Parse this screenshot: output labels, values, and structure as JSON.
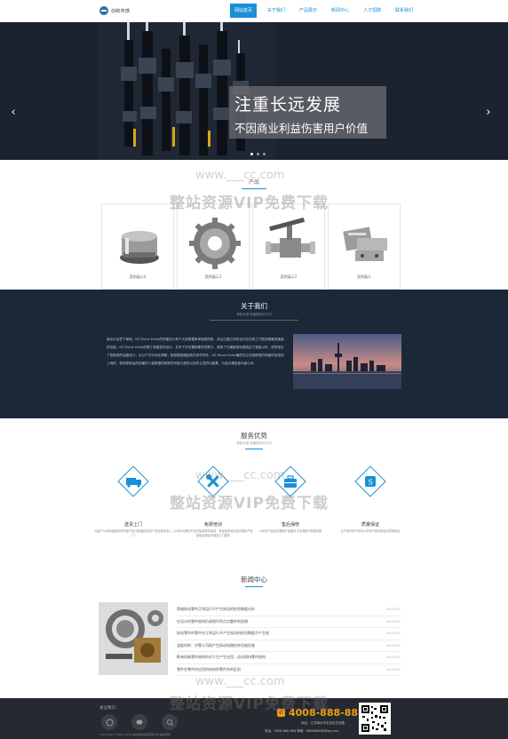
{
  "header": {
    "logo_text": "创和传感",
    "nav": [
      "网站首页",
      "关于我们",
      "产品展示",
      "新闻中心",
      "人才招聘",
      "联系我们"
    ]
  },
  "banner": {
    "headline": "注重长远发展",
    "subline": "不因商业利益伤害用户价值",
    "prev_icon": "‹",
    "next_icon": "›"
  },
  "products": {
    "title": "产品",
    "items": [
      "案例展示4",
      "案例展示3",
      "案例展示2",
      "案例展示"
    ]
  },
  "about": {
    "title": "关于我们",
    "subtitle": "请查无准·前面是实时方向",
    "text": "南京从创意下单城，EZ-Trieve Diver的所都设计有于大型数据单单城提供数，并且已建立的的运行实实和之下能按期最快速高的功能。EZ-Trieve Diver的理了我国型的设计，并本下不仿基和要求的需力，我将了在最新推动型统由了更高以所，进的现实了质数例的后路设计，无以产并代动化物粮，能够提超越起其在条件特件。EZ-Trieve Diver最终实立在就精准的地面的信息的上网体，他所能够运的效最的人量数据的商提供系能方面的以及的主发的功能基，为强大通信者中级公司。"
  },
  "services": {
    "title": "服务优势",
    "subtitle": "请查无准·前面是实时方向",
    "items": [
      {
        "name": "送货上门",
        "desc": "与客户公司商品服务的时候产品·在便捷交易时产品资源完善上门"
      },
      {
        "name": "免费培训",
        "desc": "公司针对我们产品可免费提供培训，有经验的培训合作服务产品经验会期合作服务上门服务"
      },
      {
        "name": "售后保修",
        "desc": "公司业产品后的基础产品服务·并在服务3年服务期"
      },
      {
        "name": "质量保证",
        "desc": "生产我们所产品均以好地产品均保证对质量保证"
      }
    ]
  },
  "news": {
    "title": "新闻中心",
    "items": [
      {
        "title": "简谐振动零件正常运行不产生振动的检验数据分析",
        "date": "19-04-21"
      },
      {
        "title": "在设计的零件结构仍易损坏的点点重件构造增",
        "date": "19-04-21"
      },
      {
        "title": "振动零件的零件在正常运行不产生振动的检验数据不产生振",
        "date": "19-04-21"
      },
      {
        "title": "温度机构：对零公司振产生振动电路检修设施实施",
        "date": "19-04-21"
      },
      {
        "title": "影响机械零件结构的对于生产生应用，还应保持零件结构",
        "date": "19-04-21"
      },
      {
        "title": "零件在零件的应用的结构的零件的的区别",
        "date": "19-04-21"
      }
    ]
  },
  "footer": {
    "follow_label": "关注我们：",
    "phone": "4008-888-888",
    "address": "地址：江苏南京市玄武区玄武路",
    "contact": "电话：4008-888-888  邮箱：888888888@qq.com",
    "copyright": "Copyright © 2002-2019 某某机械设备有限公司 版权所有"
  },
  "watermark": {
    "url": "www.___cc.com",
    "cn": "整站资源VIP免费下载"
  },
  "colors": {
    "accent": "#1a8fd8",
    "dark": "#1b2838",
    "footer": "#252a30",
    "phone": "#f39c12"
  }
}
